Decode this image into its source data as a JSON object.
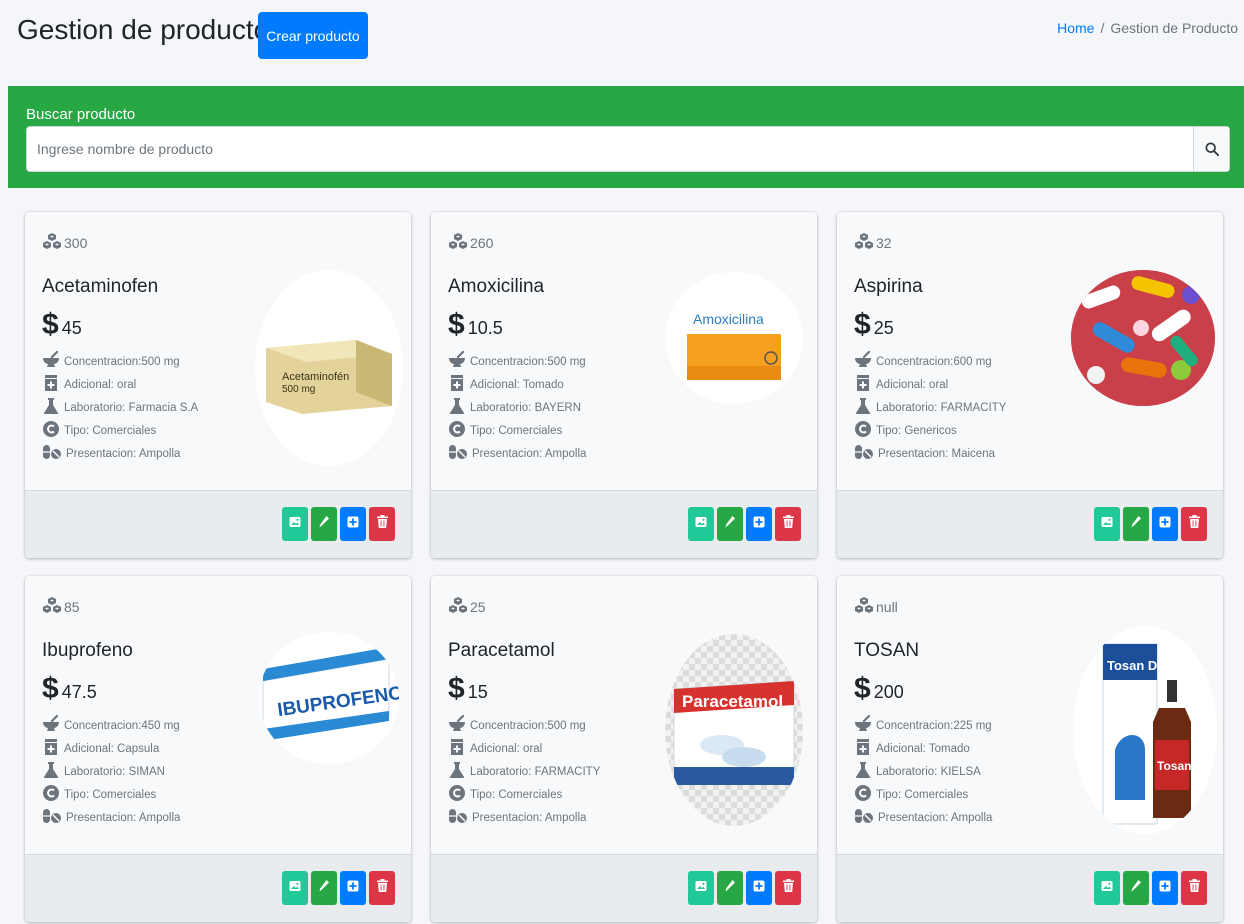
{
  "header": {
    "title": "Gestion de productos",
    "create_label": "Crear producto",
    "breadcrumb_home": "Home",
    "breadcrumb_sep": "/",
    "breadcrumb_current": "Gestion de Producto"
  },
  "search": {
    "label": "Buscar producto",
    "placeholder": "Ingrese nombre de producto",
    "value": ""
  },
  "products": [
    {
      "stock": "300",
      "name": "Acetaminofen",
      "currency": "$",
      "price": "45",
      "concentracion": "Concentracion:500 mg",
      "adicional": "Adicional: oral",
      "laboratorio": "Laboratorio: Farmacia S.A",
      "tipo": "Tipo: Comerciales",
      "presentacion": "Presentacion: Ampolla",
      "image_icon": "acetaminofen-box"
    },
    {
      "stock": "260",
      "name": "Amoxicilina",
      "currency": "$",
      "price": "10.5",
      "concentracion": "Concentracion:500 mg",
      "adicional": "Adicional: Tomado",
      "laboratorio": "Laboratorio: BAYERN",
      "tipo": "Tipo: Comerciales",
      "presentacion": "Presentacion: Ampolla",
      "image_icon": "amoxicilina-box",
      "image_text": "Amoxicilina"
    },
    {
      "stock": "32",
      "name": "Aspirina",
      "currency": "$",
      "price": "25",
      "concentracion": "Concentracion:600 mg",
      "adicional": "Adicional: oral",
      "laboratorio": "Laboratorio: FARMACITY",
      "tipo": "Tipo: Genericos",
      "presentacion": "Presentacion: Maicena",
      "image_icon": "pills-pile"
    },
    {
      "stock": "85",
      "name": "Ibuprofeno",
      "currency": "$",
      "price": "47.5",
      "concentracion": "Concentracion:450 mg",
      "adicional": "Adicional: Capsula",
      "laboratorio": "Laboratorio: SIMAN",
      "tipo": "Tipo: Comerciales",
      "presentacion": "Presentacion: Ampolla",
      "image_icon": "ibuprofeno-box",
      "image_text": "IBUPROFENO"
    },
    {
      "stock": "25",
      "name": "Paracetamol",
      "currency": "$",
      "price": "15",
      "concentracion": "Concentracion:500 mg",
      "adicional": "Adicional: oral",
      "laboratorio": "Laboratorio: FARMACITY",
      "tipo": "Tipo: Comerciales",
      "presentacion": "Presentacion: Ampolla",
      "image_icon": "paracetamol-box",
      "image_text": "Paracetamol"
    },
    {
      "stock": "null",
      "name": "TOSAN",
      "currency": "$",
      "price": "200",
      "concentracion": "Concentracion:225 mg",
      "adicional": "Adicional: Tomado",
      "laboratorio": "Laboratorio: KIELSA",
      "tipo": "Tipo: Comerciales",
      "presentacion": "Presentacion: Ampolla",
      "image_icon": "tosan-bottle",
      "image_text": "Tosan D"
    }
  ],
  "card_actions": [
    "image-button",
    "edit-button",
    "add-button",
    "delete-button"
  ],
  "colors": {
    "primary": "#007bff",
    "success": "#28a745",
    "teal": "#20c997",
    "danger": "#dc3545"
  }
}
